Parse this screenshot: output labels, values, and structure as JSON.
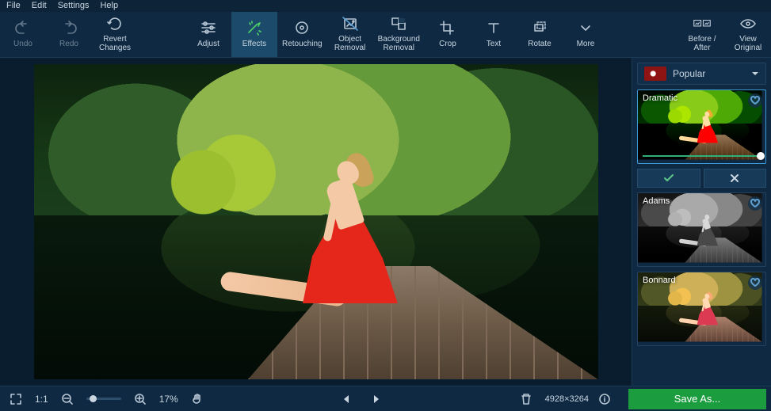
{
  "menubar": {
    "file": "File",
    "edit": "Edit",
    "settings": "Settings",
    "help": "Help"
  },
  "toolbar": {
    "undo": "Undo",
    "redo": "Redo",
    "revert": "Revert\nChanges",
    "adjust": "Adjust",
    "effects": "Effects",
    "retouching": "Retouching",
    "object_removal": "Object\nRemoval",
    "background_removal": "Background\nRemoval",
    "crop": "Crop",
    "text": "Text",
    "rotate": "Rotate",
    "more": "More",
    "before_after": "Before /\nAfter",
    "view_original": "View\nOriginal"
  },
  "effects_panel": {
    "category": "Popular",
    "presets": [
      {
        "name": "Dramatic",
        "selected": true,
        "slider": 100
      },
      {
        "name": "Adams",
        "selected": false
      },
      {
        "name": "Bonnard",
        "selected": false
      }
    ]
  },
  "statusbar": {
    "fit_label": "1:1",
    "zoom_percent": "17%",
    "dimensions": "4928×3264",
    "save_label": "Save As..."
  },
  "colors": {
    "accent_green": "#1b9c3e",
    "panel": "#0f2943",
    "bg": "#0d2438"
  }
}
